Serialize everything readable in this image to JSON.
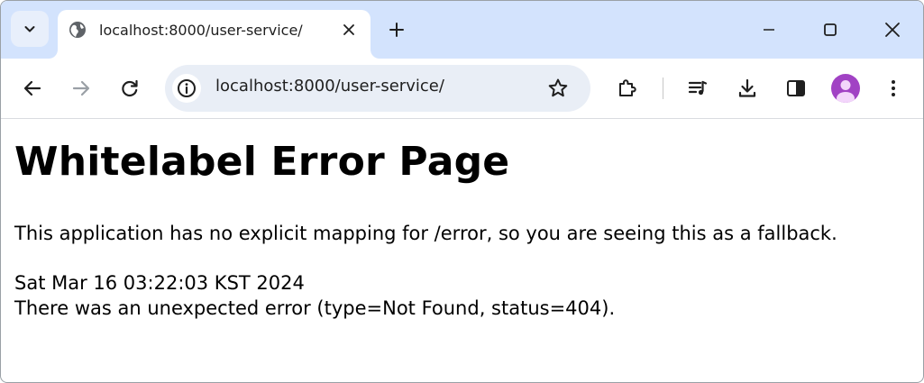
{
  "tab": {
    "title": "localhost:8000/user-service/"
  },
  "omnibox": {
    "url": "localhost:8000/user-service/"
  },
  "icons": {
    "tab_search": "chevron-down-icon",
    "favicon": "globe-icon",
    "close": "close-icon",
    "new_tab": "plus-icon",
    "back": "back-arrow-icon",
    "forward": "forward-arrow-icon",
    "reload": "reload-icon",
    "info": "info-icon",
    "bookmark": "star-icon",
    "extensions": "puzzle-icon",
    "media": "media-queue-icon",
    "downloads": "download-icon",
    "side_panel": "side-panel-icon",
    "profile": "avatar-icon",
    "menu": "kebab-menu-icon"
  },
  "colors": {
    "tabstrip": "#d3e3fd",
    "omnibox": "#e9eef6",
    "avatar": "#a142c4"
  },
  "page": {
    "heading": "Whitelabel Error Page",
    "message": "This application has no explicit mapping for /error, so you are seeing this as a fallback.",
    "timestamp": "Sat Mar 16 03:22:03 KST 2024",
    "error": "There was an unexpected error (type=Not Found, status=404)."
  }
}
